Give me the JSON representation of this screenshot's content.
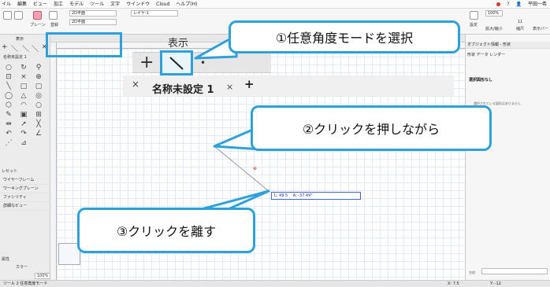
{
  "menubar": {
    "items": [
      "イル",
      "編集",
      "ビュー",
      "加工",
      "モデル",
      "ツール",
      "文字",
      "ウインドウ",
      "Cloud",
      "ヘルプ(H)"
    ],
    "user": "平田一希"
  },
  "ribbon": {
    "layer_field": "2D平面",
    "layer2": "レイヤ-1",
    "zoom_level": "100%",
    "zoom_caption": "拡大/縮小",
    "scale_caption": "縮尺",
    "display_caption": "表示バー",
    "scale_value": "11",
    "register": "登録",
    "plane": "プレーン",
    "settings": "設定"
  },
  "leftbar": {
    "display_label": "表示",
    "tab": "名称未設定 1",
    "panel_title": "レセット",
    "layers": [
      "ワイヤーフレーム",
      "ワーキングプレーン",
      "ファシリティ",
      "詳細なビュー"
    ],
    "attr_label": "属性",
    "color_label": "カラー",
    "percent": "100%"
  },
  "zoom": {
    "title": "表示",
    "plus": "+",
    "angle_mode": "＼",
    "diag_mode": "•",
    "close": "×",
    "doc_name": "名称未設定 1",
    "close2": "×",
    "add": "+"
  },
  "drawing": {
    "dim_length": "L: 49.5",
    "dim_angle": "A: -37.49°",
    "marker": "⊕"
  },
  "rightpanel": {
    "header": "オブジェクト情報 - 形状",
    "tabs": "形状  データ  レンダー",
    "selection": "選択図形なし",
    "message": "選択されている図形はありません",
    "name_label": "名前:"
  },
  "statusbar": {
    "tool": "ツール 2 任意角度モード",
    "x": "X: 7.5",
    "y": "Y: -12"
  },
  "callouts": {
    "step1": "①任意角度モードを選択",
    "step2": "②クリックを押しながら",
    "step3": "③クリックを離す"
  },
  "colors": {
    "accent": "#2ea0da",
    "grid": "#e3eaf3"
  }
}
